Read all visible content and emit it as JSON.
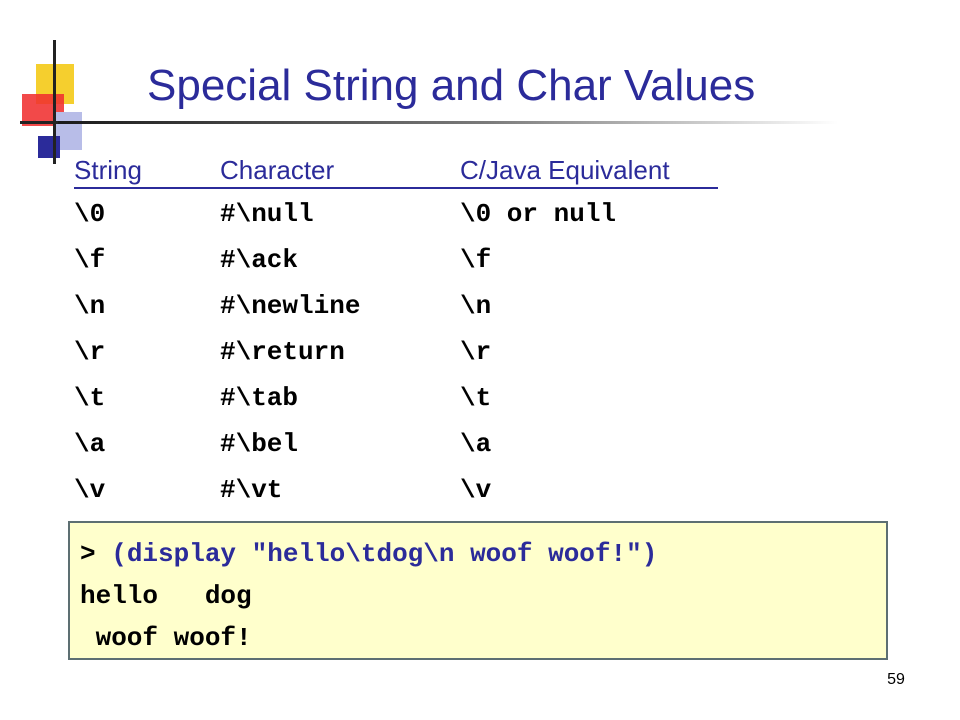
{
  "slide": {
    "title": "Special String and Char Values",
    "page_number": "59"
  },
  "table": {
    "headers": [
      "String",
      "Character",
      "C/Java Equivalent"
    ],
    "rows": [
      [
        "\\0",
        "#\\null",
        "\\0 or null"
      ],
      [
        "\\f",
        "#\\ack",
        "\\f"
      ],
      [
        "\\n",
        "#\\newline",
        "\\n"
      ],
      [
        "\\r",
        "#\\return",
        "\\r"
      ],
      [
        "\\t",
        "#\\tab",
        "\\t"
      ],
      [
        "\\a",
        "#\\bel",
        "\\a"
      ],
      [
        "\\v",
        "#\\vt",
        "\\v"
      ]
    ]
  },
  "repl": {
    "prompt": ">",
    "command": "(display \"hello\\tdog\\n woof woof!\")",
    "output_lines": [
      "hello   dog",
      " woof woof!"
    ]
  },
  "colors": {
    "title": "#2b2b9a",
    "header_text": "#2b2b9a",
    "body_text": "#000000",
    "command_text": "#2b2b9a",
    "repl_background": "#ffffcc",
    "repl_border": "#5d6f72",
    "logo_yellow": "#f5cf2e",
    "logo_red": "#f03030",
    "logo_blue": "#2b2b9a",
    "logo_lavender": "#b8bde8"
  }
}
